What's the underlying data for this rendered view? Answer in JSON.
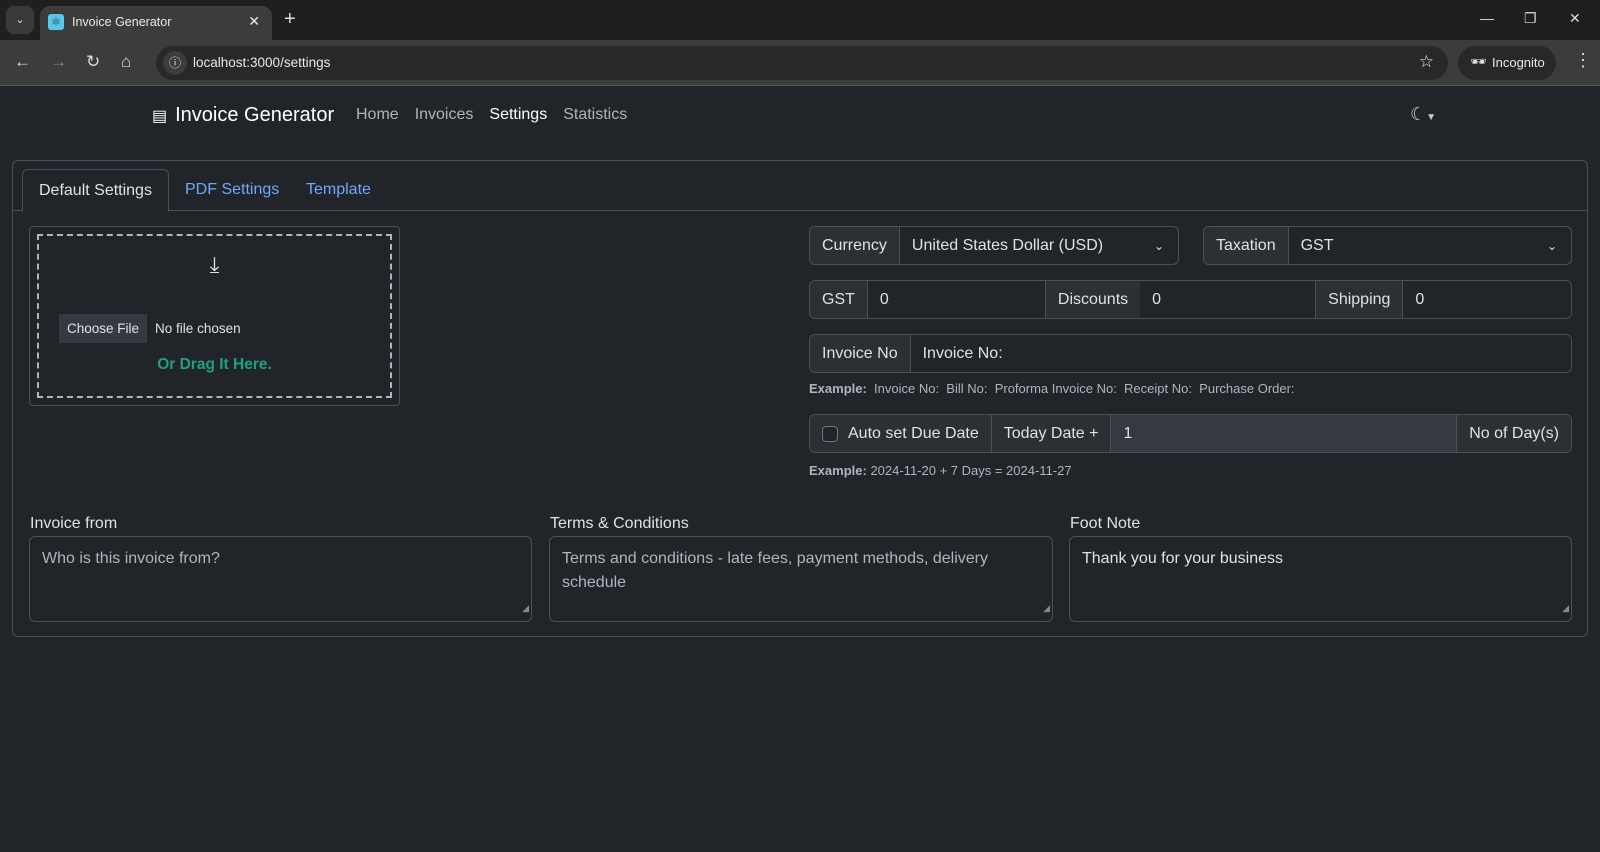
{
  "browser": {
    "tab_title": "Invoice Generator",
    "url": "localhost:3000/settings",
    "profile": "Incognito"
  },
  "navbar": {
    "brand": "Invoice Generator",
    "links": [
      "Home",
      "Invoices",
      "Settings",
      "Statistics"
    ]
  },
  "tabs": [
    "Default Settings",
    "PDF Settings",
    "Template"
  ],
  "upload": {
    "button": "Choose File",
    "status": "No file chosen",
    "drag_text": "Or Drag It Here."
  },
  "currency": {
    "label": "Currency",
    "value": "United States Dollar (USD)"
  },
  "taxation": {
    "label": "Taxation",
    "value": "GST"
  },
  "gst": {
    "label": "GST",
    "value": "0"
  },
  "discounts": {
    "label": "Discounts",
    "value": "0"
  },
  "shipping": {
    "label": "Shipping",
    "value": "0"
  },
  "invoice_no": {
    "label": "Invoice No",
    "value": "Invoice No:",
    "example_label": "Example:",
    "example": "Invoice No:  Bill No:  Proforma Invoice No:  Receipt No:  Purchase Order:"
  },
  "due_date": {
    "checkbox_label": "Auto set Due Date",
    "prefix": "Today Date +",
    "value": "1",
    "suffix": "No of Day(s)",
    "example_label": "Example:",
    "example": "2024-11-20 + 7 Days = 2024-11-27"
  },
  "invoice_from": {
    "label": "Invoice from",
    "placeholder": "Who is this invoice from?"
  },
  "terms": {
    "label": "Terms & Conditions",
    "placeholder": "Terms and conditions - late fees, payment methods, delivery schedule"
  },
  "footnote": {
    "label": "Foot Note",
    "value": "Thank you for your business"
  }
}
